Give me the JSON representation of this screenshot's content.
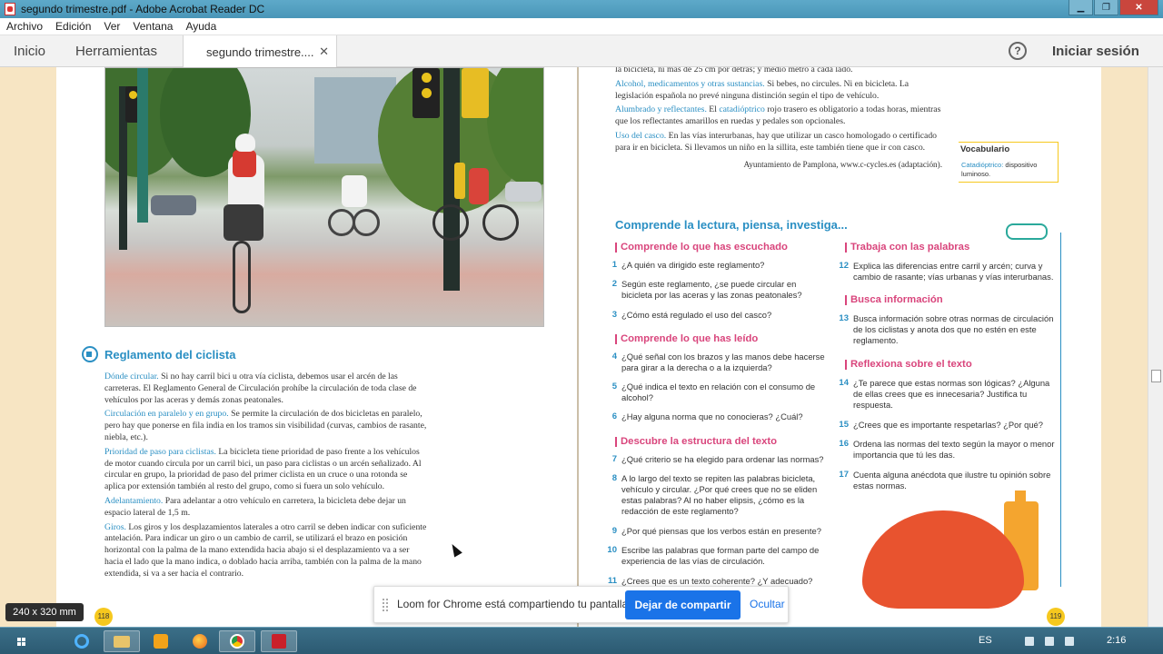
{
  "window": {
    "title": "segundo trimestre.pdf - Adobe Acrobat Reader DC"
  },
  "menu": [
    "Archivo",
    "Edición",
    "Ver",
    "Ventana",
    "Ayuda"
  ],
  "tabs": {
    "home": "Inicio",
    "tools": "Herramientas",
    "document": "segundo trimestre....",
    "close": "✕"
  },
  "header": {
    "help": "?",
    "sign_in": "Iniciar sesión"
  },
  "left_page": {
    "section_title": "Reglamento del ciclista",
    "paragraphs": [
      {
        "kw": "Dónde circular.",
        "text": " Si no hay carril bici u otra vía ciclista, debemos usar el arcén de las carreteras. El Reglamento General de Circulación prohíbe la circulación de toda clase de vehículos por las aceras y demás zonas peatonales."
      },
      {
        "kw": "Circulación en paralelo y en grupo.",
        "text": " Se permite la circulación de dos bicicletas en paralelo, pero hay que ponerse en fila india en los tramos sin visibilidad (curvas, cambios de rasante, niebla, etc.)."
      },
      {
        "kw": "Prioridad de paso para ciclistas.",
        "text": " La bicicleta tiene prioridad de paso frente a los vehículos de motor cuando circula por un carril bici, un paso para ciclistas o un arcén señalizado. Al circular en grupo, la prioridad de paso del primer ciclista en un cruce o una rotonda se aplica por extensión también al resto del grupo, como si fuera un solo vehículo."
      },
      {
        "kw": "Adelantamiento.",
        "text": " Para adelantar a otro vehículo en carretera, la bicicleta debe dejar un espacio lateral de 1,5 m."
      },
      {
        "kw": "Giros.",
        "text": " Los giros y los desplazamientos laterales a otro carril se deben indicar con suficiente antelación. Para indicar un giro o un cambio de carril, se utilizará el brazo en posición horizontal con la palma de la mano extendida hacia abajo si el desplazamiento va a ser hacia el lado que la mano indica, o doblado hacia arriba, también con la palma de la mano extendida, si va a ser hacia el contrario."
      }
    ],
    "page_number": "118"
  },
  "right_page": {
    "top_fragment": "la bicicleta, ni más de 25 cm por detrás; y medio metro a cada lado.",
    "paragraphs": [
      {
        "kw": "Alcohol, medicamentos y otras sustancias.",
        "text": " Si bebes, no circules. Ni en bicicleta. La legislación española no prevé ninguna distinción según el tipo de vehículo."
      },
      {
        "kw": "Alumbrado y reflectantes.",
        "text": " El ",
        "kw2": "catadióptrico",
        "text2": " rojo trasero es obligatorio a todas horas, mientras que los reflectantes amarillos en ruedas y pedales son opcionales."
      },
      {
        "kw": "Uso del casco.",
        "text": " En las vías interurbanas, hay que utilizar un casco homologado o certificado para ir en bicicleta. Si llevamos un niño en la sillita, este también tiene que ir con casco."
      }
    ],
    "source": "Ayuntamiento de Pamplona, www.c-cycles.es (adaptación).",
    "vocab": {
      "title": "Vocabulario",
      "term": "Catadióptrico:",
      "definition": " dispositivo luminoso."
    },
    "activity_title": "Comprende la lectura, piensa, investiga...",
    "col1": [
      {
        "heading": "Comprende lo que has escuchado",
        "items": [
          {
            "n": "1",
            "t": "¿A quién va dirigido este reglamento?"
          },
          {
            "n": "2",
            "t": "Según este reglamento, ¿se puede circular en bicicleta por las aceras y las zonas peatonales?"
          },
          {
            "n": "3",
            "t": "¿Cómo está regulado el uso del casco?"
          }
        ]
      },
      {
        "heading": "Comprende lo que has leído",
        "items": [
          {
            "n": "4",
            "t": "¿Qué señal con los brazos y las manos debe hacerse para girar a la derecha o a la izquierda?"
          },
          {
            "n": "5",
            "t": "¿Qué indica el texto en relación con el consumo de alcohol?"
          },
          {
            "n": "6",
            "t": "¿Hay alguna norma que no conocieras? ¿Cuál?"
          }
        ]
      },
      {
        "heading": "Descubre la estructura del texto",
        "items": [
          {
            "n": "7",
            "t": "¿Qué criterio se ha elegido para ordenar las normas?"
          },
          {
            "n": "8",
            "t": "A lo largo del texto se repiten las palabras bicicleta, vehículo y circular. ¿Por qué crees que no se eliden estas palabras? Al no haber elipsis, ¿cómo es la redacción de este reglamento?"
          },
          {
            "n": "9",
            "t": "¿Por qué piensas que los verbos están en presente?"
          },
          {
            "n": "10",
            "t": "Escribe las palabras que forman parte del campo de experiencia de las vías de circulación."
          },
          {
            "n": "11",
            "t": "¿Crees que es un texto coherente? ¿Y adecuado?"
          }
        ]
      }
    ],
    "col2": [
      {
        "heading": "Trabaja con las palabras",
        "items": [
          {
            "n": "12",
            "t": "Explica las diferencias entre carril y arcén; curva y cambio de rasante; vías urbanas y vías interurbanas."
          }
        ]
      },
      {
        "heading": "Busca información",
        "items": [
          {
            "n": "13",
            "t": "Busca información sobre otras normas de circulación de los ciclistas y anota dos que no estén en este reglamento.",
            "bold_prefix": "Busca información"
          }
        ]
      },
      {
        "heading": "Reflexiona sobre el texto",
        "items": [
          {
            "n": "14",
            "t": "¿Te parece que estas normas son lógicas? ¿Alguna de ellas crees que es innecesaria? Justifica tu respuesta."
          },
          {
            "n": "15",
            "t": "¿Crees que es importante respetarlas? ¿Por qué?"
          },
          {
            "n": "16",
            "t": "Ordena las normas del texto según la mayor o menor importancia que tú les das."
          },
          {
            "n": "17",
            "t": "Cuenta alguna anécdota que ilustre tu opinión sobre estas normas."
          }
        ]
      }
    ],
    "page_number": "119"
  },
  "page_size_badge": "240 x 320 mm",
  "share_bar": {
    "message": "Loom for Chrome está compartiendo tu pantalla.",
    "stop_label": "Dejar de compartir",
    "hide_label": "Ocultar"
  },
  "taskbar": {
    "language": "ES",
    "time": "2:16"
  }
}
